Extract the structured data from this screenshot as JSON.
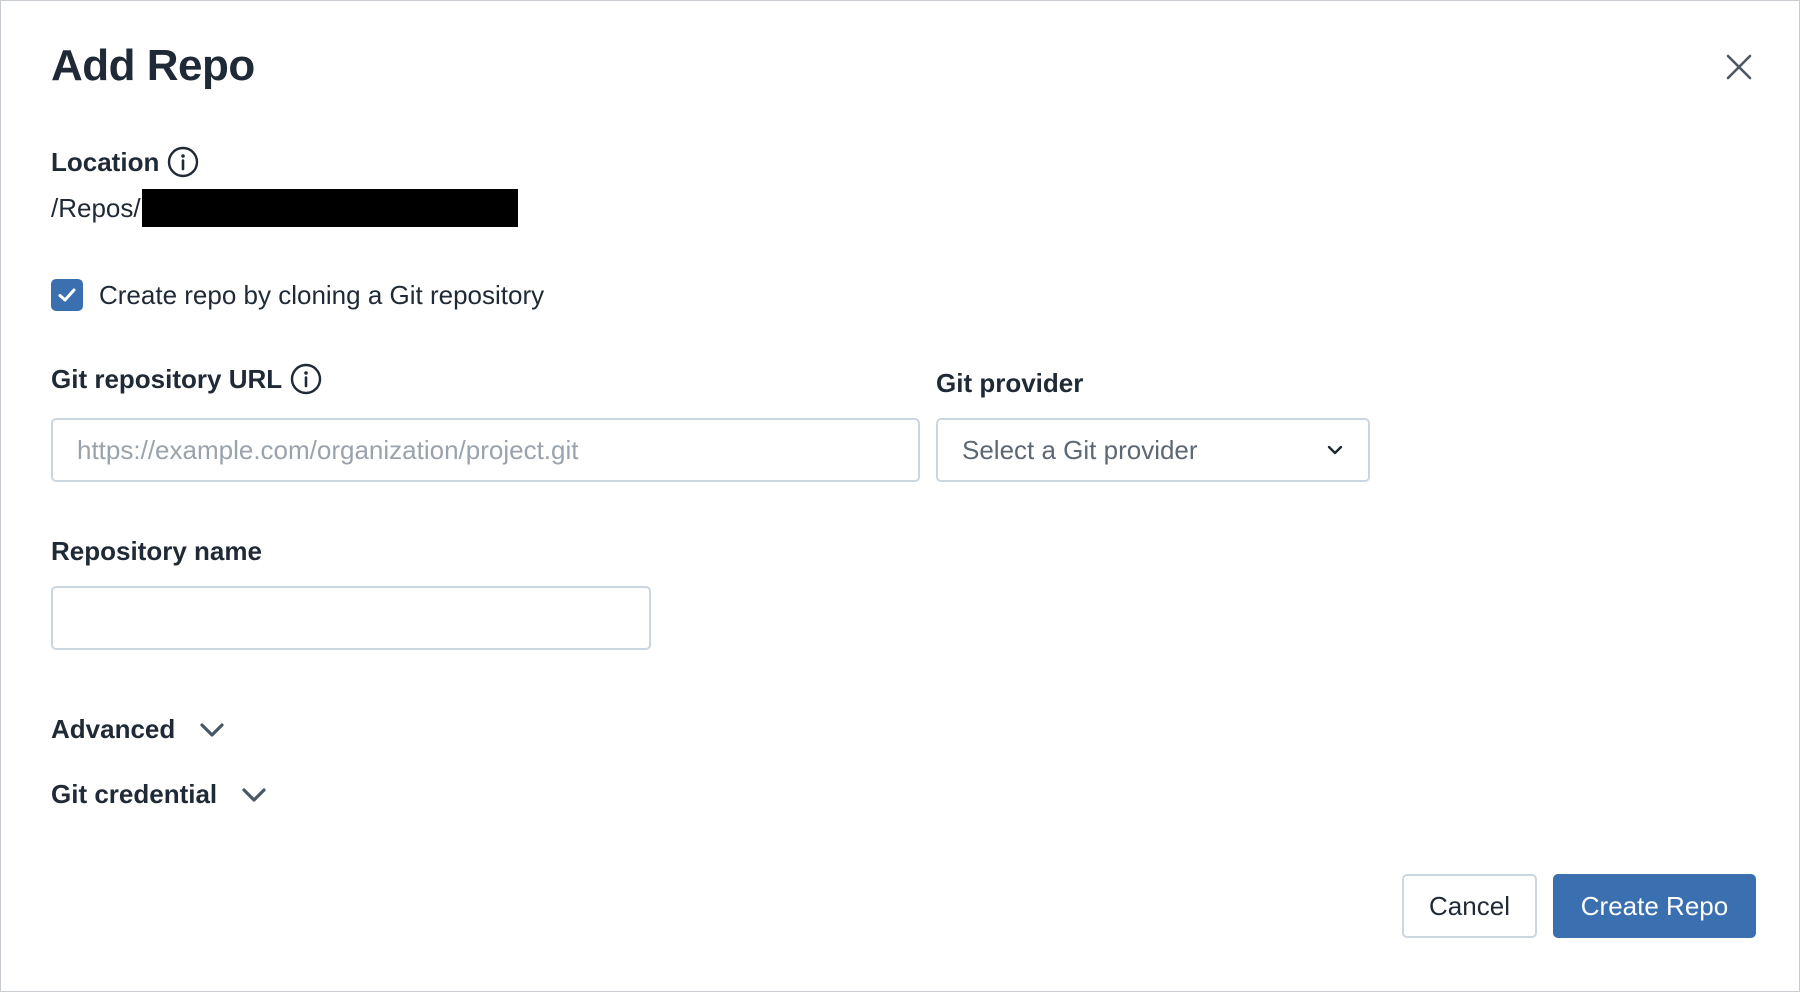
{
  "dialog": {
    "title": "Add Repo"
  },
  "location": {
    "label": "Location",
    "path_prefix": "/Repos/"
  },
  "clone": {
    "label": "Create repo by cloning a Git repository",
    "checked": true
  },
  "git_url": {
    "label": "Git repository URL",
    "value": "",
    "placeholder": "https://example.com/organization/project.git"
  },
  "git_provider": {
    "label": "Git provider",
    "selected": "Select a Git provider"
  },
  "repo_name": {
    "label": "Repository name",
    "value": ""
  },
  "sections": {
    "advanced": "Advanced",
    "git_credential": "Git credential"
  },
  "actions": {
    "cancel": "Cancel",
    "create": "Create Repo"
  },
  "colors": {
    "primary": "#3a6fb0",
    "text": "#1f2a36",
    "border": "#ccd6e0",
    "icon": "#4a5866"
  },
  "icons": {
    "close": "close-icon",
    "info": "info-icon",
    "check": "checkmark-icon",
    "chevron": "chevron-down-icon"
  }
}
